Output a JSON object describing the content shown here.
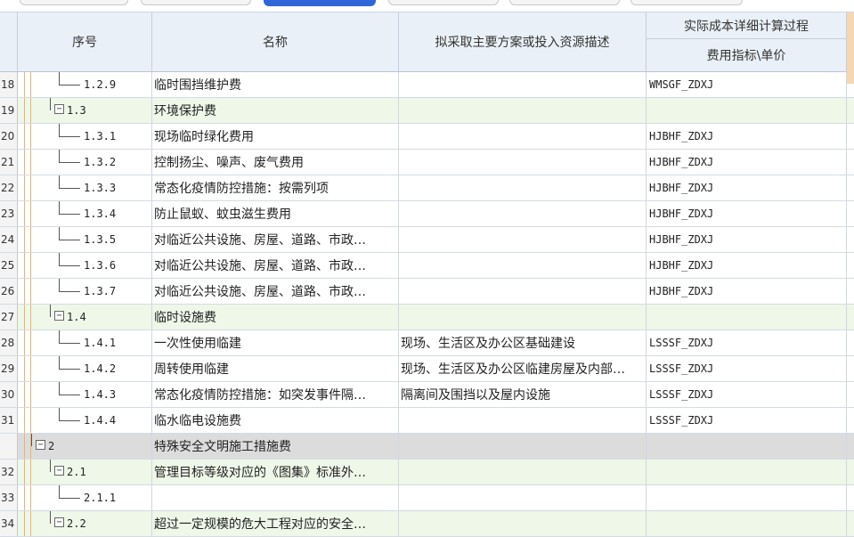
{
  "header": {
    "seq": "序号",
    "name": "名称",
    "desc": "拟采取主要方案或投入资源描述",
    "cost_group": "实际成本详细计算过程",
    "cost_sub": "费用指标\\单价"
  },
  "rows": [
    {
      "num": "18",
      "seq": "1.2.9",
      "name": "临时围挡维护费",
      "desc": "",
      "cost": "WMSGF_ZDXJ",
      "type": "leaf",
      "level": 3
    },
    {
      "num": "19",
      "seq": "1.3",
      "name": "环境保护费",
      "desc": "",
      "cost": "",
      "type": "group",
      "level": 2
    },
    {
      "num": "20",
      "seq": "1.3.1",
      "name": "现场临时绿化费用",
      "desc": "",
      "cost": "HJBHF_ZDXJ",
      "type": "leaf",
      "level": 3
    },
    {
      "num": "21",
      "seq": "1.3.2",
      "name": "控制扬尘、噪声、废气费用",
      "desc": "",
      "cost": "HJBHF_ZDXJ",
      "type": "leaf",
      "level": 3
    },
    {
      "num": "22",
      "seq": "1.3.3",
      "name": "常态化疫情防控措施：按需列项",
      "desc": "",
      "cost": "HJBHF_ZDXJ",
      "type": "leaf",
      "level": 3
    },
    {
      "num": "23",
      "seq": "1.3.4",
      "name": "防止鼠蚁、蚊虫滋生费用",
      "desc": "",
      "cost": "HJBHF_ZDXJ",
      "type": "leaf",
      "level": 3
    },
    {
      "num": "24",
      "seq": "1.3.5",
      "name": "对临近公共设施、房屋、道路、市政…",
      "desc": "",
      "cost": "HJBHF_ZDXJ",
      "type": "leaf",
      "level": 3
    },
    {
      "num": "25",
      "seq": "1.3.6",
      "name": "对临近公共设施、房屋、道路、市政…",
      "desc": "",
      "cost": "HJBHF_ZDXJ",
      "type": "leaf",
      "level": 3
    },
    {
      "num": "26",
      "seq": "1.3.7",
      "name": "对临近公共设施、房屋、道路、市政…",
      "desc": "",
      "cost": "HJBHF_ZDXJ",
      "type": "leaf",
      "level": 3
    },
    {
      "num": "27",
      "seq": "1.4",
      "name": "临时设施费",
      "desc": "",
      "cost": "",
      "type": "group",
      "level": 2
    },
    {
      "num": "28",
      "seq": "1.4.1",
      "name": "一次性使用临建",
      "desc": "现场、生活区及办公区基础建设",
      "cost": "LSSSF_ZDXJ",
      "type": "leaf",
      "level": 3
    },
    {
      "num": "29",
      "seq": "1.4.2",
      "name": "周转使用临建",
      "desc": "现场、生活区及办公区临建房屋及内部…",
      "cost": "LSSSF_ZDXJ",
      "type": "leaf",
      "level": 3
    },
    {
      "num": "30",
      "seq": "1.4.3",
      "name": "常态化疫情防控措施：如突发事件隔…",
      "desc": "隔离间及围挡以及屋内设施",
      "cost": "LSSSF_ZDXJ",
      "type": "leaf",
      "level": 3
    },
    {
      "num": "31",
      "seq": "1.4.4",
      "name": "临水临电设施费",
      "desc": "",
      "cost": "LSSSF_ZDXJ",
      "type": "leaf",
      "level": 3
    },
    {
      "num": "",
      "seq": "2",
      "name": "特殊安全文明施工措施费",
      "desc": "",
      "cost": "",
      "type": "top",
      "level": 1
    },
    {
      "num": "32",
      "seq": "2.1",
      "name": "管理目标等级对应的《图集》标准外…",
      "desc": "",
      "cost": "",
      "type": "group",
      "level": 2
    },
    {
      "num": "33",
      "seq": "2.1.1",
      "name": "",
      "desc": "",
      "cost": "",
      "type": "leaf",
      "level": 3
    },
    {
      "num": "34",
      "seq": "2.2",
      "name": "超过一定规模的危大工程对应的安全…",
      "desc": "",
      "cost": "",
      "type": "group",
      "level": 2
    }
  ],
  "colors": {
    "group_row": "#eef7e8",
    "top_row": "#dcdcdc",
    "header": "#eaf0f7",
    "tab_active": "#2f67d8"
  }
}
